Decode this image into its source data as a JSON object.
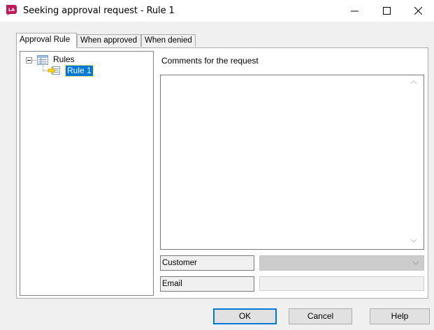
{
  "window": {
    "title": "Seeking approval request - Rule 1",
    "app_icon": "la-app-icon",
    "controls": [
      "minimize-icon",
      "maximize-icon",
      "close-icon"
    ]
  },
  "tabs": [
    {
      "label": "Approval Rule",
      "active": true
    },
    {
      "label": "When approved",
      "active": false
    },
    {
      "label": "When denied",
      "active": false
    }
  ],
  "tree": {
    "root": {
      "label": "Rules",
      "expanded": true,
      "icon": "rules-list-icon"
    },
    "children": [
      {
        "label": "Rule 1",
        "selected": true,
        "icon": "rule-arrow-icon"
      }
    ]
  },
  "form": {
    "comments_label": "Comments for the request",
    "comments_value": "",
    "customer_label": "Customer",
    "customer_value": "",
    "email_label": "Email",
    "email_value": ""
  },
  "buttons": {
    "ok": "OK",
    "cancel": "Cancel",
    "help": "Help"
  },
  "colors": {
    "selection": "#0078d7",
    "default_button_border": "#0078d7",
    "app_icon": "#c2185b"
  }
}
